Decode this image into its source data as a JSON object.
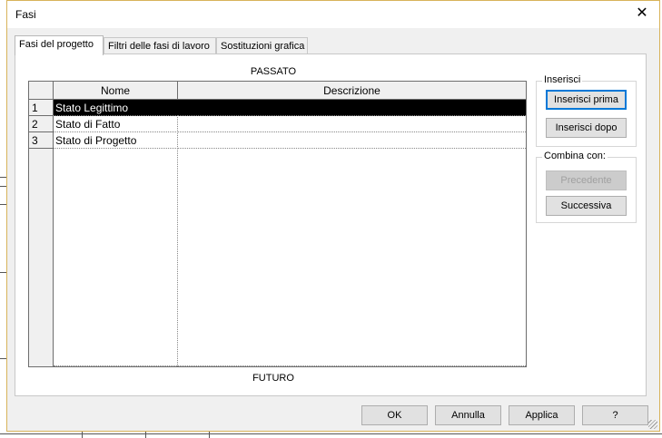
{
  "window": {
    "title": "Fasi",
    "close_glyph": "✕"
  },
  "tabs": [
    {
      "label": "Fasi del progetto",
      "active": true
    },
    {
      "label": "Filtri delle fasi di lavoro",
      "active": false
    },
    {
      "label": "Sostituzioni grafica",
      "active": false
    }
  ],
  "phases": {
    "past_label": "PASSATO",
    "future_label": "FUTURO",
    "columns": {
      "name": "Nome",
      "description": "Descrizione"
    },
    "rows": [
      {
        "num": "1",
        "name": "Stato Legittimo",
        "description": "",
        "selected": true
      },
      {
        "num": "2",
        "name": "Stato di Fatto",
        "description": "",
        "selected": false
      },
      {
        "num": "3",
        "name": "Stato di Progetto",
        "description": "",
        "selected": false
      }
    ]
  },
  "insert_group": {
    "legend": "Inserisci",
    "insert_before": "Inserisci prima",
    "insert_after": "Inserisci dopo"
  },
  "combine_group": {
    "legend": "Combina con:",
    "previous": "Precedente",
    "next": "Successiva"
  },
  "footer": {
    "ok": "OK",
    "cancel": "Annulla",
    "apply": "Applica",
    "help": "?"
  },
  "colors": {
    "selection": "#000000",
    "focus_border": "#0078d7",
    "dialog_bg": "#f0f0f0"
  }
}
